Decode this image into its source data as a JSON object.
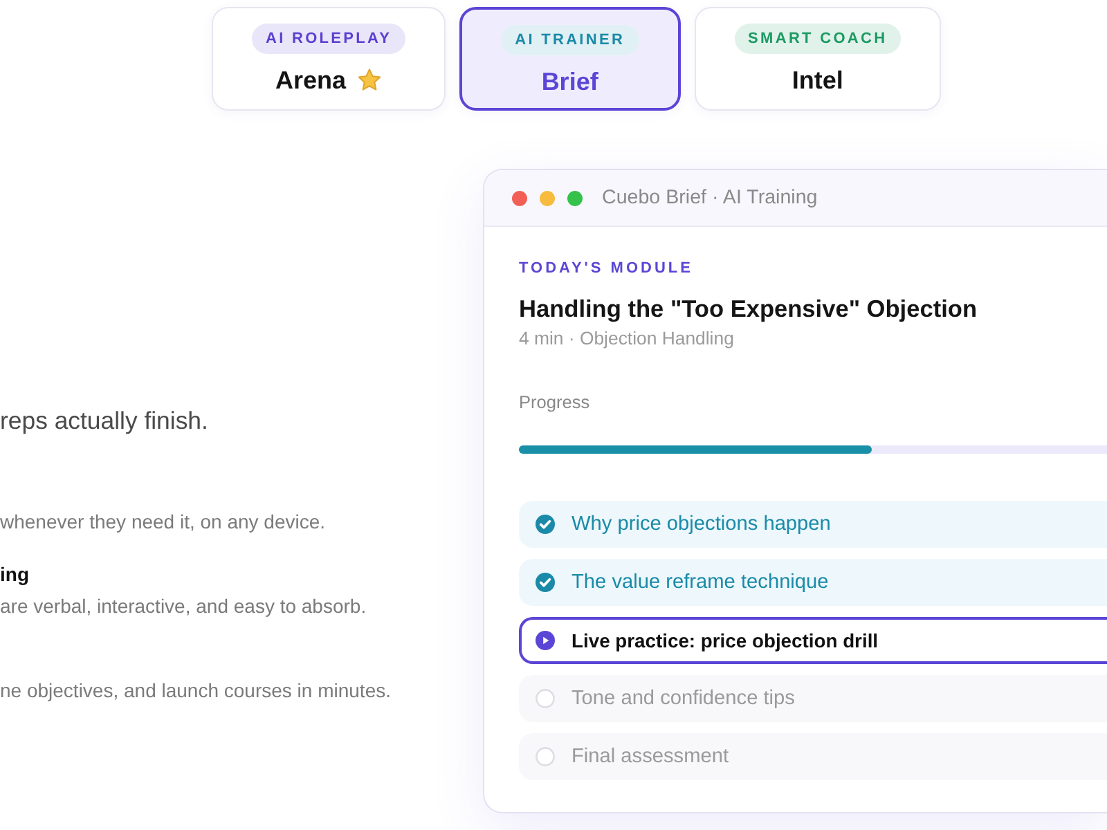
{
  "tabs": [
    {
      "badge": "AI ROLEPLAY",
      "color": "#5b3fd0",
      "title": "Arena",
      "starred": true,
      "selected": false
    },
    {
      "badge": "AI TRAINER",
      "color": "#1a8aa8",
      "title": "Brief",
      "starred": false,
      "selected": true
    },
    {
      "badge": "SMART COACH",
      "color": "#1c9a62",
      "title": "Intel",
      "starred": false,
      "selected": false
    }
  ],
  "intro": "reps actually finish.",
  "features": [
    {
      "description": "whenever they need it, on any device."
    },
    {
      "title": "ing",
      "description": "are verbal, interactive, and easy to absorb."
    },
    {
      "description": "ne objectives, and launch courses in minutes."
    }
  ],
  "window": {
    "title": "Cuebo Brief · AI Training",
    "eyebrow": "TODAY'S MODULE",
    "module_title": "Handling the \"Too Expensive\" Objection",
    "meta": "4 min · Objection Handling",
    "progress": {
      "label": "Progress",
      "level": 0.6
    },
    "lessons": [
      {
        "label": "Why price objections happen",
        "checked": true,
        "selected": false
      },
      {
        "label": "The value reframe technique",
        "checked": true,
        "selected": false
      },
      {
        "label": "Live practice: price objection drill",
        "checked": false,
        "selected": true
      },
      {
        "label": "Tone and confidence tips",
        "checked": false,
        "selected": false
      },
      {
        "label": "Final assessment",
        "checked": false,
        "selected": false
      }
    ]
  }
}
